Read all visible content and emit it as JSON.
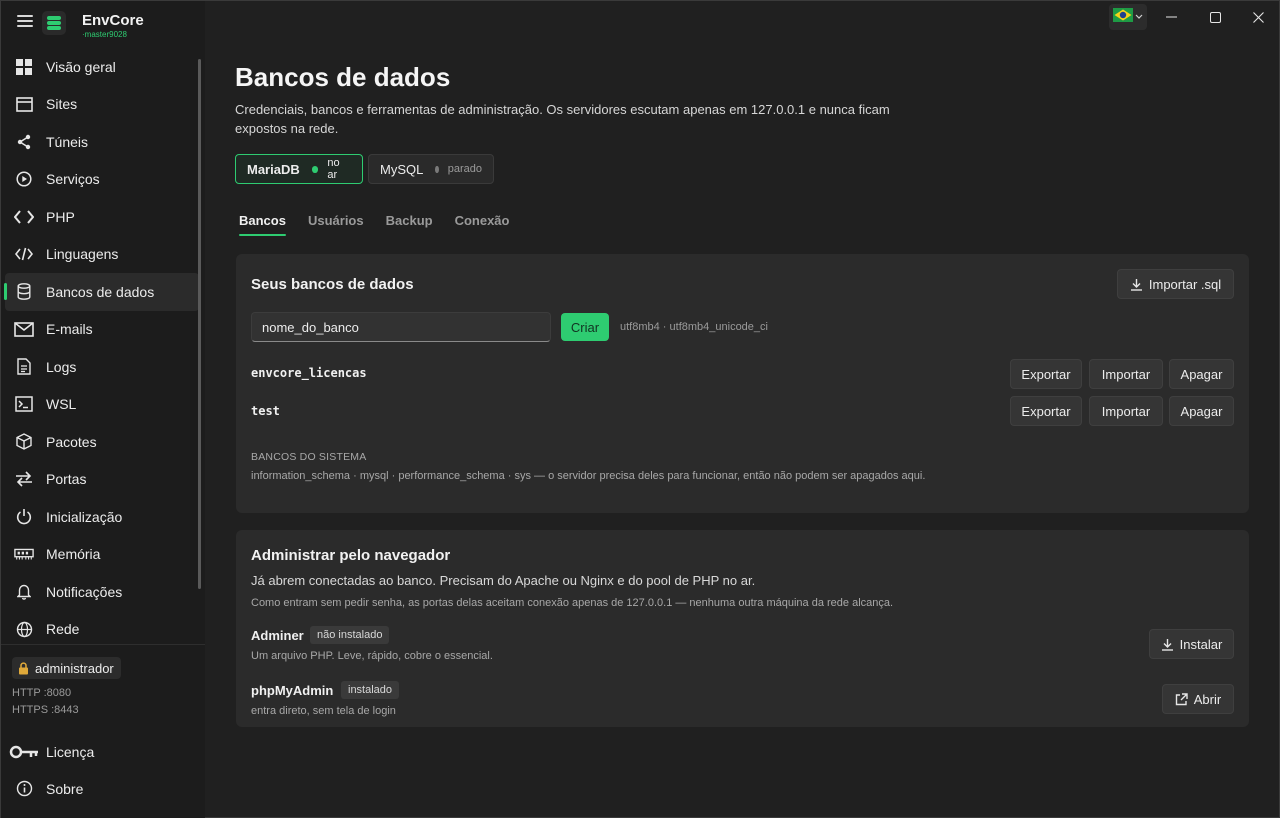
{
  "app": {
    "name": "EnvCore",
    "version": "·master9028"
  },
  "sidebar": {
    "items": [
      {
        "label": "Visão geral",
        "icon": "grid-icon"
      },
      {
        "label": "Sites",
        "icon": "browser-window-icon"
      },
      {
        "label": "Túneis",
        "icon": "share-icon"
      },
      {
        "label": "Serviços",
        "icon": "play-circle-icon"
      },
      {
        "label": "PHP",
        "icon": "code-brackets-icon"
      },
      {
        "label": "Linguagens",
        "icon": "code-slash-icon"
      },
      {
        "label": "Bancos de dados",
        "icon": "database-icon"
      },
      {
        "label": "E-mails",
        "icon": "mail-icon"
      },
      {
        "label": "Logs",
        "icon": "document-icon"
      },
      {
        "label": "WSL",
        "icon": "terminal-icon"
      },
      {
        "label": "Pacotes",
        "icon": "package-icon"
      },
      {
        "label": "Portas",
        "icon": "swap-arrows-icon"
      },
      {
        "label": "Inicialização",
        "icon": "power-icon"
      },
      {
        "label": "Memória",
        "icon": "memory-chip-icon"
      },
      {
        "label": "Notificações",
        "icon": "bell-icon"
      },
      {
        "label": "Rede",
        "icon": "globe-icon"
      }
    ],
    "active_index": 6,
    "user": "administrador",
    "http": "HTTP :8080",
    "https": "HTTPS :8443",
    "license": "Licença",
    "about": "Sobre"
  },
  "page": {
    "title": "Bancos de dados",
    "description": "Credenciais, bancos e ferramentas de administração. Os servidores escutam apenas em 127.0.0.1 e nunca ficam expostos na rede."
  },
  "engines": [
    {
      "name": "MariaDB",
      "state": "no ar",
      "status_color": "#2ecc71",
      "active": true
    },
    {
      "name": "MySQL",
      "state": "parado",
      "status_color": "#7a7a7a",
      "active": false
    }
  ],
  "tabs": [
    "Bancos",
    "Usuários",
    "Backup",
    "Conexão"
  ],
  "databases_card": {
    "title": "Seus bancos de dados",
    "import_label": "Importar .sql",
    "input_value": "nome_do_banco",
    "create_label": "Criar",
    "collation": "utf8mb4 · utf8mb4_unicode_ci",
    "rows": [
      {
        "name": "envcore_licencas"
      },
      {
        "name": "test"
      }
    ],
    "row_actions": {
      "export": "Exportar",
      "import": "Importar",
      "delete": "Apagar"
    },
    "system_heading": "BANCOS DO SISTEMA",
    "system_text": "information_schema · mysql · performance_schema · sys  — o servidor precisa deles para funcionar, então não podem ser apagados aqui."
  },
  "admin_card": {
    "title": "Administrar pelo navegador",
    "subtitle": "Já abrem conectadas ao banco. Precisam do Apache ou Nginx e do pool de PHP no ar.",
    "note": "Como entram sem pedir senha, as portas delas aceitam conexão apenas de 127.0.0.1 — nenhuma outra máquina da rede alcança.",
    "tools": [
      {
        "name": "Adminer",
        "badge": "não instalado",
        "desc": "Um arquivo PHP. Leve, rápido, cobre o essencial.",
        "action": "Instalar",
        "action_icon": "download-icon"
      },
      {
        "name": "phpMyAdmin",
        "badge": "instalado",
        "desc": "entra direto, sem tela de login",
        "action": "Abrir",
        "action_icon": "external-link-icon"
      }
    ]
  },
  "colors": {
    "accent": "#2ecc71",
    "background": "#202020",
    "sidebar": "#1c1c1c",
    "card": "#2b2b2b"
  }
}
